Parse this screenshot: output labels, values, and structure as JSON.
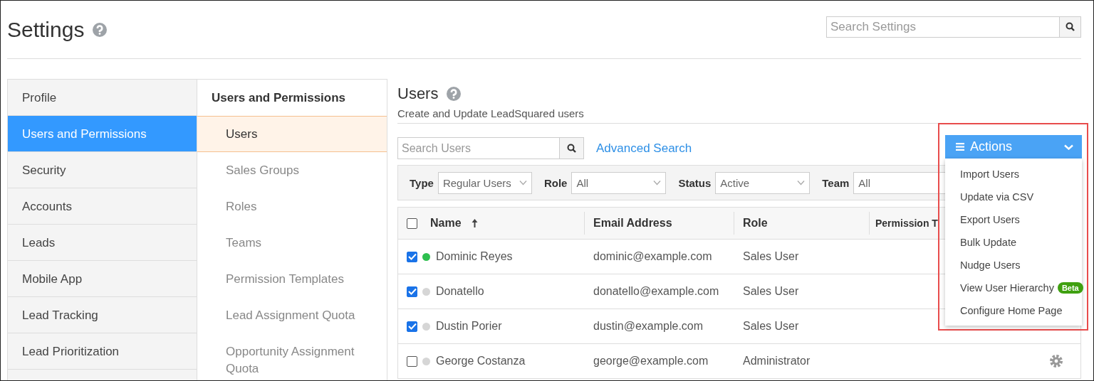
{
  "page": {
    "title": "Settings"
  },
  "search": {
    "placeholder": "Search Settings"
  },
  "nav": {
    "items": [
      {
        "label": "Profile",
        "selected": false
      },
      {
        "label": "Users and Permissions",
        "selected": true
      },
      {
        "label": "Security",
        "selected": false
      },
      {
        "label": "Accounts",
        "selected": false
      },
      {
        "label": "Leads",
        "selected": false
      },
      {
        "label": "Mobile App",
        "selected": false
      },
      {
        "label": "Lead Tracking",
        "selected": false
      },
      {
        "label": "Lead Prioritization",
        "selected": false
      }
    ]
  },
  "subnav": {
    "heading": "Users and Permissions",
    "items": [
      {
        "label": "Users",
        "selected": true
      },
      {
        "label": "Sales Groups",
        "selected": false
      },
      {
        "label": "Roles",
        "selected": false
      },
      {
        "label": "Teams",
        "selected": false
      },
      {
        "label": "Permission Templates",
        "selected": false
      },
      {
        "label": "Lead Assignment Quota",
        "selected": false
      },
      {
        "label": "Opportunity Assignment Quota",
        "selected": false
      }
    ]
  },
  "content": {
    "title": "Users",
    "subtitle": "Create and Update LeadSquared users",
    "search": {
      "placeholder": "Search Users"
    },
    "advanced_search": "Advanced Search",
    "filters": [
      {
        "label": "Type",
        "value": "Regular Users"
      },
      {
        "label": "Role",
        "value": "All"
      },
      {
        "label": "Status",
        "value": "Active"
      },
      {
        "label": "Team",
        "value": "All"
      }
    ],
    "table": {
      "all_checked": false,
      "columns": [
        {
          "label": "Name",
          "sorted_ascending": true
        },
        {
          "label": "Email Address",
          "sorted_ascending": false
        },
        {
          "label": "Role",
          "sorted_ascending": false
        },
        {
          "label": "Permission T",
          "sorted_ascending": false
        }
      ],
      "rows": [
        {
          "checked": true,
          "color": "#2ebf4f",
          "name": "Dominic Reyes",
          "email": "dominic@example.com",
          "role": "Sales User",
          "settings_icon": false
        },
        {
          "checked": true,
          "color": "#d6d6d6",
          "name": "Donatello",
          "email": "donatello@example.com",
          "role": "Sales User",
          "settings_icon": false
        },
        {
          "checked": true,
          "color": "#d6d6d6",
          "name": "Dustin Porier",
          "email": "dustin@example.com",
          "role": "Sales User",
          "settings_icon": false
        },
        {
          "checked": false,
          "color": "#d6d6d6",
          "name": "George Costanza",
          "email": "george@example.com",
          "role": "Administrator",
          "settings_icon": true
        }
      ]
    }
  },
  "actions_menu": {
    "label": "Actions",
    "expanded": true,
    "highlighted": true,
    "items": [
      {
        "label": "Import Users"
      },
      {
        "label": "Update via CSV"
      },
      {
        "label": "Export Users"
      },
      {
        "label": "Bulk Update"
      },
      {
        "label": "Nudge Users"
      },
      {
        "label": "View User Hierarchy",
        "badge": "Beta"
      },
      {
        "label": "Configure Home Page"
      }
    ]
  }
}
